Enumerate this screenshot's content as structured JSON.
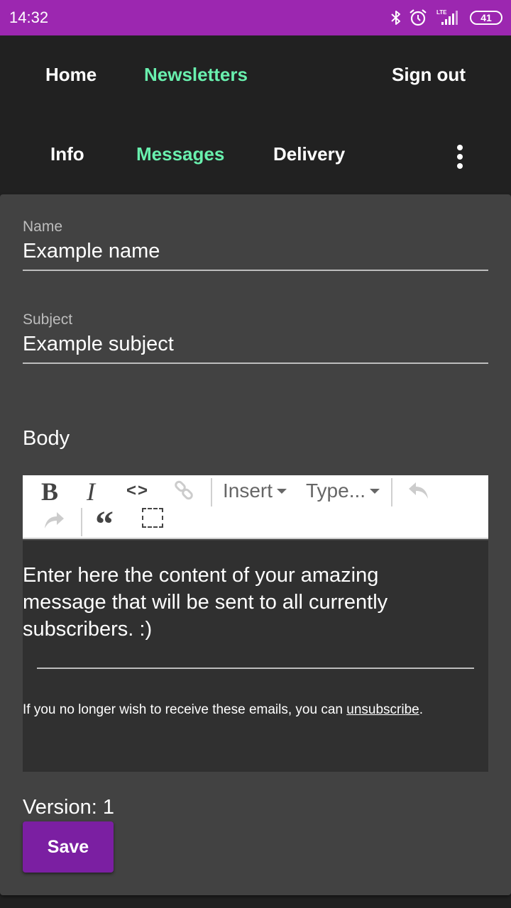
{
  "status_bar": {
    "time": "14:32",
    "network": "LTE",
    "battery": "41",
    "icons": [
      "bluetooth-icon",
      "alarm-icon",
      "signal-icon",
      "battery-icon"
    ],
    "color": "#9c27b0"
  },
  "top_nav": {
    "home": "Home",
    "newsletters": "Newsletters",
    "sign_out": "Sign out",
    "active_color": "#69f0ae"
  },
  "sub_nav": {
    "info": "Info",
    "messages": "Messages",
    "delivery": "Delivery",
    "more_icon": "more-vert-icon"
  },
  "form": {
    "name_label": "Name",
    "name_value": "Example name",
    "subject_label": "Subject",
    "subject_value": "Example subject",
    "body_label": "Body"
  },
  "toolbar": {
    "bold": "B",
    "italic": "I",
    "code": "<>",
    "insert": "Insert",
    "type": "Type...",
    "quote": "“",
    "icons": [
      "bold-icon",
      "italic-icon",
      "code-icon",
      "link-icon",
      "undo-icon",
      "redo-icon",
      "blockquote-icon",
      "select-block-icon"
    ]
  },
  "editor": {
    "content": "Enter here the content of your amazing message that will be sent to all currently subscribers. :)",
    "footer_text": "If you no longer wish to receive these emails, you can ",
    "footer_link": "unsubscribe",
    "footer_end": "."
  },
  "version": {
    "label": "Version: 1"
  },
  "actions": {
    "save": "Save",
    "save_color": "#7b1fa2"
  }
}
